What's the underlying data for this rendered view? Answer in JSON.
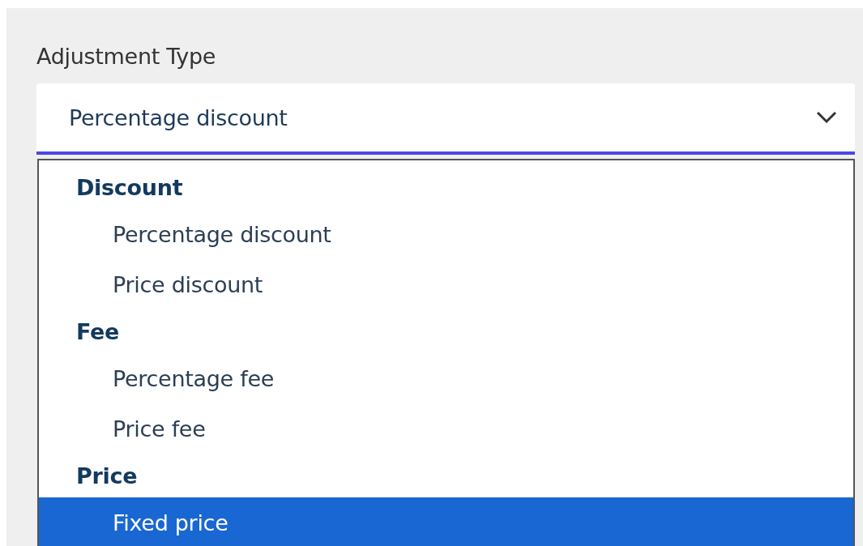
{
  "field": {
    "label": "Adjustment Type",
    "value": "Percentage discount",
    "expanded": true
  },
  "options": [
    {
      "group": "Discount",
      "items": [
        {
          "label": "Percentage discount",
          "selected": false
        },
        {
          "label": "Price discount",
          "selected": false
        }
      ]
    },
    {
      "group": "Fee",
      "items": [
        {
          "label": "Percentage fee",
          "selected": false
        },
        {
          "label": "Price fee",
          "selected": false
        }
      ]
    },
    {
      "group": "Price",
      "items": [
        {
          "label": "Fixed price",
          "selected": true
        }
      ]
    }
  ]
}
